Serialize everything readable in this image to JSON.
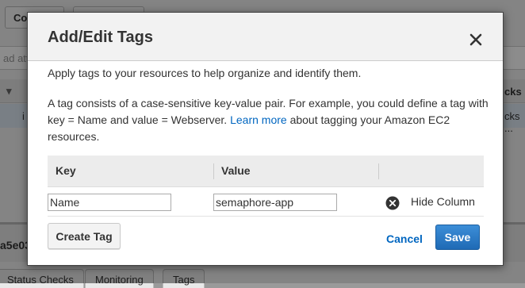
{
  "background": {
    "toolbar_buttons": [
      "Co",
      ""
    ],
    "filter_placeholder": "ad attr",
    "column_fragment_right": "cks",
    "row_fragment_left": "i",
    "row_fragment_right": "cks ...",
    "instance_id_fragment": "a5e03",
    "tabs": [
      "Status Checks",
      "Monitoring",
      "Tags"
    ]
  },
  "modal": {
    "title": "Add/Edit Tags",
    "close_icon": "close-icon",
    "intro": "Apply tags to your resources to help organize and identify them.",
    "desc_before": "A tag consists of a case-sensitive key-value pair. For example, you could define a tag with key = Name and value = Webserver.",
    "desc_link": "Learn more",
    "desc_after": "about tagging your Amazon EC2 resources.",
    "table": {
      "headers": {
        "key": "Key",
        "value": "Value"
      },
      "rows": [
        {
          "key": "Name",
          "value": "semaphore-app",
          "remove_icon": "remove-circle-icon"
        }
      ],
      "hide_column_label": "Hide Column"
    },
    "buttons": {
      "create_tag": "Create Tag",
      "cancel": "Cancel",
      "save": "Save"
    }
  },
  "colors": {
    "link": "#0066c0",
    "primary_button": "#1f6ab5"
  }
}
